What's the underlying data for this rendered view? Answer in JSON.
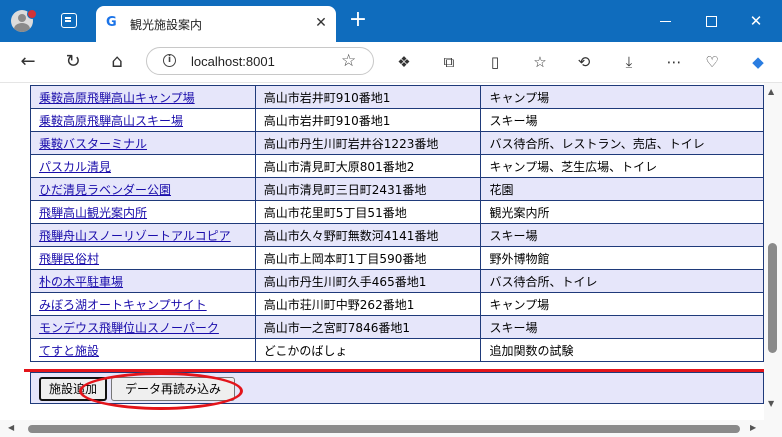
{
  "browser": {
    "tab_title": "観光施設案内",
    "tab_favicon": "G",
    "url": "localhost:8001",
    "icons": {
      "profile": "profile-avatar-icon",
      "tab_actions": "tab-actions-icon",
      "close": "close-icon",
      "new_tab": "plus-icon",
      "back": "back-arrow-icon",
      "reload": "reload-icon",
      "home": "home-icon",
      "info": "info-icon",
      "favorite": "star-icon"
    },
    "glyphs": {
      "close": "✕",
      "new_tab": "+",
      "win_close": "✕",
      "back": "←",
      "reload": "↻",
      "home": "⌂",
      "info": "i",
      "star": "☆",
      "ext1": "❖",
      "ext2": "⧉",
      "split": "▯",
      "favorites": "☆",
      "history": "⟲",
      "download": "⤓",
      "more": "⋯",
      "copilot": "◆"
    }
  },
  "table": {
    "rows": [
      {
        "name": "乗鞍高原飛騨高山キャンプ場",
        "address": "高山市岩井町910番地1",
        "facilities": "キャンプ場"
      },
      {
        "name": "乗鞍高原飛騨高山スキー場",
        "address": "高山市岩井町910番地1",
        "facilities": "スキー場"
      },
      {
        "name": "乗鞍バスターミナル",
        "address": "高山市丹生川町岩井谷1223番地",
        "facilities": "バス待合所、レストラン、売店、トイレ"
      },
      {
        "name": "パスカル清見",
        "address": "高山市清見町大原801番地2",
        "facilities": "キャンプ場、芝生広場、トイレ"
      },
      {
        "name": "ひだ清見ラベンダー公園",
        "address": "高山市清見町三日町2431番地",
        "facilities": "花園"
      },
      {
        "name": "飛騨高山観光案内所",
        "address": "高山市花里町5丁目51番地",
        "facilities": "観光案内所"
      },
      {
        "name": "飛騨舟山スノーリゾートアルコピア",
        "address": "高山市久々野町無数河4141番地",
        "facilities": "スキー場"
      },
      {
        "name": "飛騨民俗村",
        "address": "高山市上岡本町1丁目590番地",
        "facilities": "野外博物館"
      },
      {
        "name": "朴の木平駐車場",
        "address": "高山市丹生川町久手465番地1",
        "facilities": "バス待合所、トイレ"
      },
      {
        "name": "みぼろ湖オートキャンプサイト",
        "address": "高山市荘川町中野262番地1",
        "facilities": "キャンプ場"
      },
      {
        "name": "モンデウス飛騨位山スノーパーク",
        "address": "高山市一之宮町7846番地1",
        "facilities": "スキー場"
      },
      {
        "name": "てすと施設",
        "address": "どこかのばしょ",
        "facilities": "追加関数の試験"
      }
    ]
  },
  "actions": {
    "add_label": "施設追加",
    "reload_label": "データ再読み込み"
  },
  "annotation": {
    "color": "#e3141a"
  }
}
